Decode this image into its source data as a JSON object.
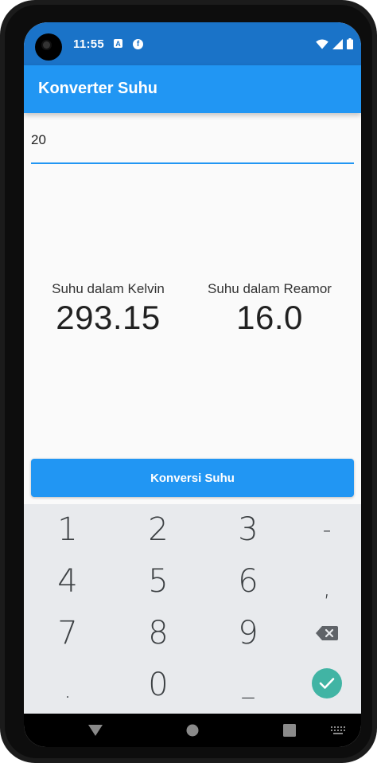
{
  "status_bar": {
    "time": "11:55",
    "icons": [
      "a-notification-icon",
      "f-notification-icon",
      "wifi-icon",
      "signal-icon",
      "battery-icon"
    ],
    "background": "#1a73c8"
  },
  "app_bar": {
    "title": "Konverter Suhu",
    "color": "#2196f3"
  },
  "input": {
    "value": "20"
  },
  "results": {
    "kelvin": {
      "label": "Suhu dalam Kelvin",
      "value": "293.15"
    },
    "reamor": {
      "label": "Suhu dalam Reamor",
      "value": "16.0"
    }
  },
  "convert_button": {
    "label": "Konversi Suhu"
  },
  "keyboard": {
    "rows": [
      [
        "1",
        "2",
        "3",
        "-"
      ],
      [
        "4",
        "5",
        "6",
        ","
      ],
      [
        "7",
        "8",
        "9",
        "backspace-icon"
      ],
      [
        ".",
        "0",
        "_",
        "done-check-icon"
      ]
    ],
    "done_color": "#41b4a4"
  },
  "nav_bar": {
    "icons": [
      "back-triangle-icon",
      "home-circle-icon",
      "recents-square-icon",
      "keyboard-switch-icon"
    ]
  }
}
